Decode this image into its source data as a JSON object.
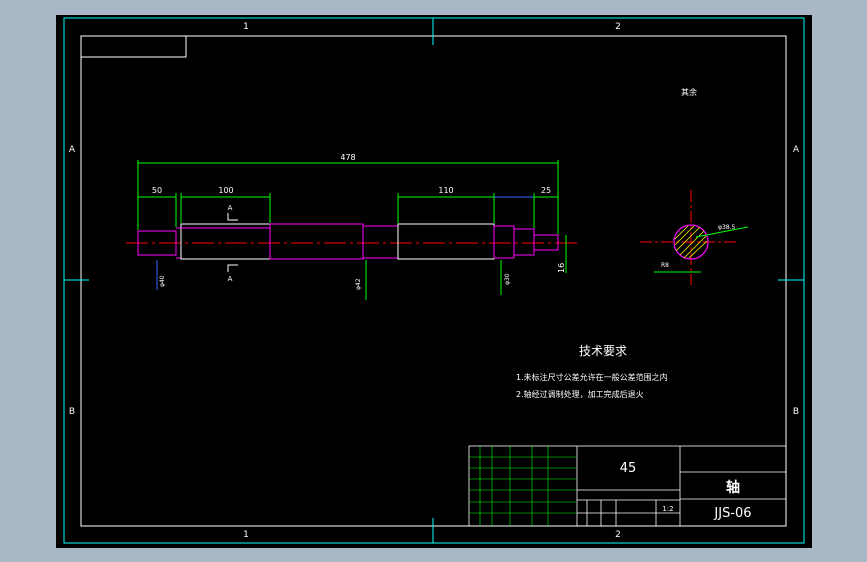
{
  "zones": {
    "top": [
      "1",
      "2"
    ],
    "bottom": [
      "1",
      "2"
    ],
    "left": [
      "A",
      "B"
    ],
    "right": [
      "A",
      "B"
    ]
  },
  "dimensions": {
    "overall_length": "478",
    "left_segment": "50",
    "left_body": "100",
    "right_body": "110",
    "right_step": "25",
    "diameter_left": "φ40",
    "diameter_mid": "φ42",
    "diameter_right": "φ30",
    "end_height": "16",
    "section_diameter": "φ38.5",
    "section_small": "R8"
  },
  "section_labels": {
    "top": "A",
    "bottom": "A"
  },
  "corner_mark": "其余",
  "tech_requirements": {
    "title": "技术要求",
    "items": [
      "1.未标注尺寸公差允许在一般公差范围之内",
      "2.轴经过调制处理，加工完成后退火"
    ]
  },
  "title_block": {
    "material": "45",
    "part_name": "轴",
    "drawing_number": "JJS-06",
    "scale": "1:2"
  },
  "colors": {
    "frame": "#ffffff",
    "cyan": "#00ffff",
    "shaft": "#ff00ff",
    "dim_green": "#00ff00",
    "center_red": "#ff0000",
    "blue": "#3366ff",
    "yellow": "#ffff00"
  }
}
